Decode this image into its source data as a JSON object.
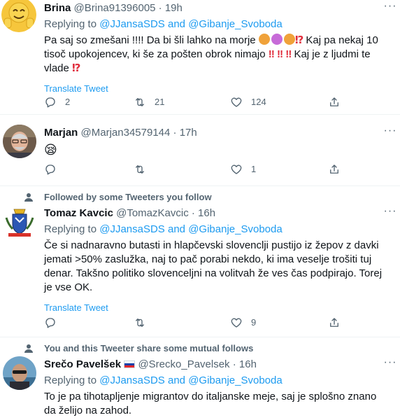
{
  "tweets": [
    {
      "name": "Brina",
      "handle": "@Brina91396005",
      "dot": "·",
      "time": "19h",
      "reply_prefix": "Replying to",
      "reply_user1": "@JJansaSDS",
      "reply_and": "and",
      "reply_user2": "@Gibanje_Svoboda",
      "text_line1_a": "Pa saj so zmešani !!!!  Da bi šli lahko na morje",
      "text_line1_b": "Kaj pa nekaj 10",
      "text_line2_a": "tisoč upokojencev,  ki še za pošten obrok nimajo",
      "text_line2_b": "Kaj je z ljudmi te",
      "text_line3_a": "vlade",
      "translate": "Translate Tweet",
      "replies": "2",
      "retweets": "21",
      "likes": "124"
    },
    {
      "name": "Marjan",
      "handle": "@Marjan34579144",
      "dot": "·",
      "time": "17h",
      "emoji": "😪",
      "replies": "",
      "retweets": "",
      "likes": "1"
    },
    {
      "social": "Followed by some Tweeters you follow",
      "name": "Tomaz Kavcic",
      "handle": "@TomazKavcic",
      "dot": "·",
      "time": "16h",
      "reply_prefix": "Replying to",
      "reply_user1": "@JJansaSDS",
      "reply_and": "and",
      "reply_user2": "@Gibanje_Svoboda",
      "text": "Če si nadnaravno butasti in hlapčevski slovenclji pustijo iz žepov z davki jemati >50% zaslužka, naj to pač porabi nekdo, ki ima veselje trošiti tuj denar. Takšno politiko slovenceljni na volitvah že ves čas podpirajo. Torej je vse OK.",
      "translate": "Translate Tweet",
      "replies": "",
      "retweets": "",
      "likes": "9"
    },
    {
      "social": "You and this Tweeter share some mutual follows",
      "name": "Srečo Pavelšek",
      "handle": "@Srecko_Pavelsek",
      "dot": "·",
      "time": "16h",
      "reply_prefix": "Replying to",
      "reply_user1": "@JJansaSDS",
      "reply_and": "and",
      "reply_user2": "@Gibanje_Svoboda",
      "text": "To je pa tihotapljenje migrantov do italjanske meje, saj je splošno znano da želijo na zahod."
    }
  ],
  "colors": {
    "link": "#1d9bf0",
    "secondary_text": "#536471",
    "primary_text": "#0f1419",
    "divider": "#eff3f4"
  },
  "icons": [
    "reply-icon",
    "retweet-icon",
    "like-icon",
    "share-icon",
    "more-icon",
    "person-icon"
  ]
}
